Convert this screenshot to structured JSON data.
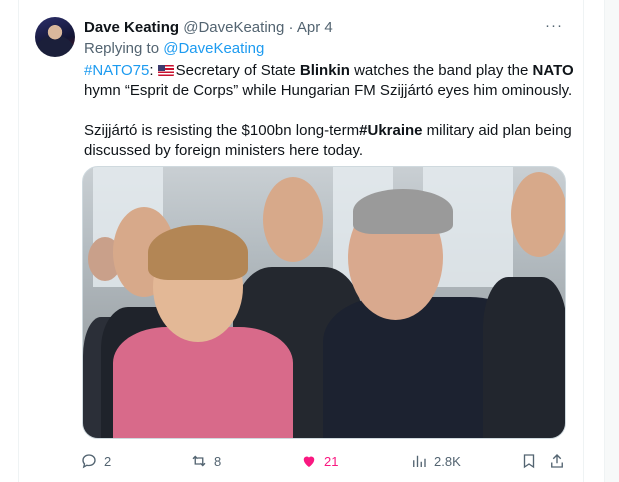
{
  "tweet": {
    "author_name": "Dave Keating",
    "author_handle": "@DaveKeating",
    "separator": "·",
    "date": "Apr 4",
    "replying_prefix": "Replying to ",
    "replying_handle": "@DaveKeating",
    "line1": {
      "hashtag": "#NATO75",
      "colon": ":",
      "t1": "Secretary of State ",
      "b1": "Blinkin",
      "t2": " watches the band play the ",
      "b2": "NATO",
      "t3": " hymn “Esprit de Corps” while Hungarian FM Szijjártó eyes him ominously."
    },
    "line2": {
      "t1": "Szijjártó is resisting the $100bn long-term",
      "b1": "#Ukraine",
      "t2": " military aid plan being discussed by foreign ministers here today."
    }
  },
  "actions": {
    "replies": "2",
    "reposts": "8",
    "likes": "21",
    "views": "2.8K"
  },
  "colors": {
    "link": "#1d9bf0",
    "like": "#f91880",
    "muted": "#536471"
  },
  "icons": [
    "avatar",
    "more-icon",
    "us-flag-icon",
    "reply-icon",
    "repost-icon",
    "heart-icon",
    "views-icon",
    "bookmark-icon",
    "share-icon"
  ]
}
